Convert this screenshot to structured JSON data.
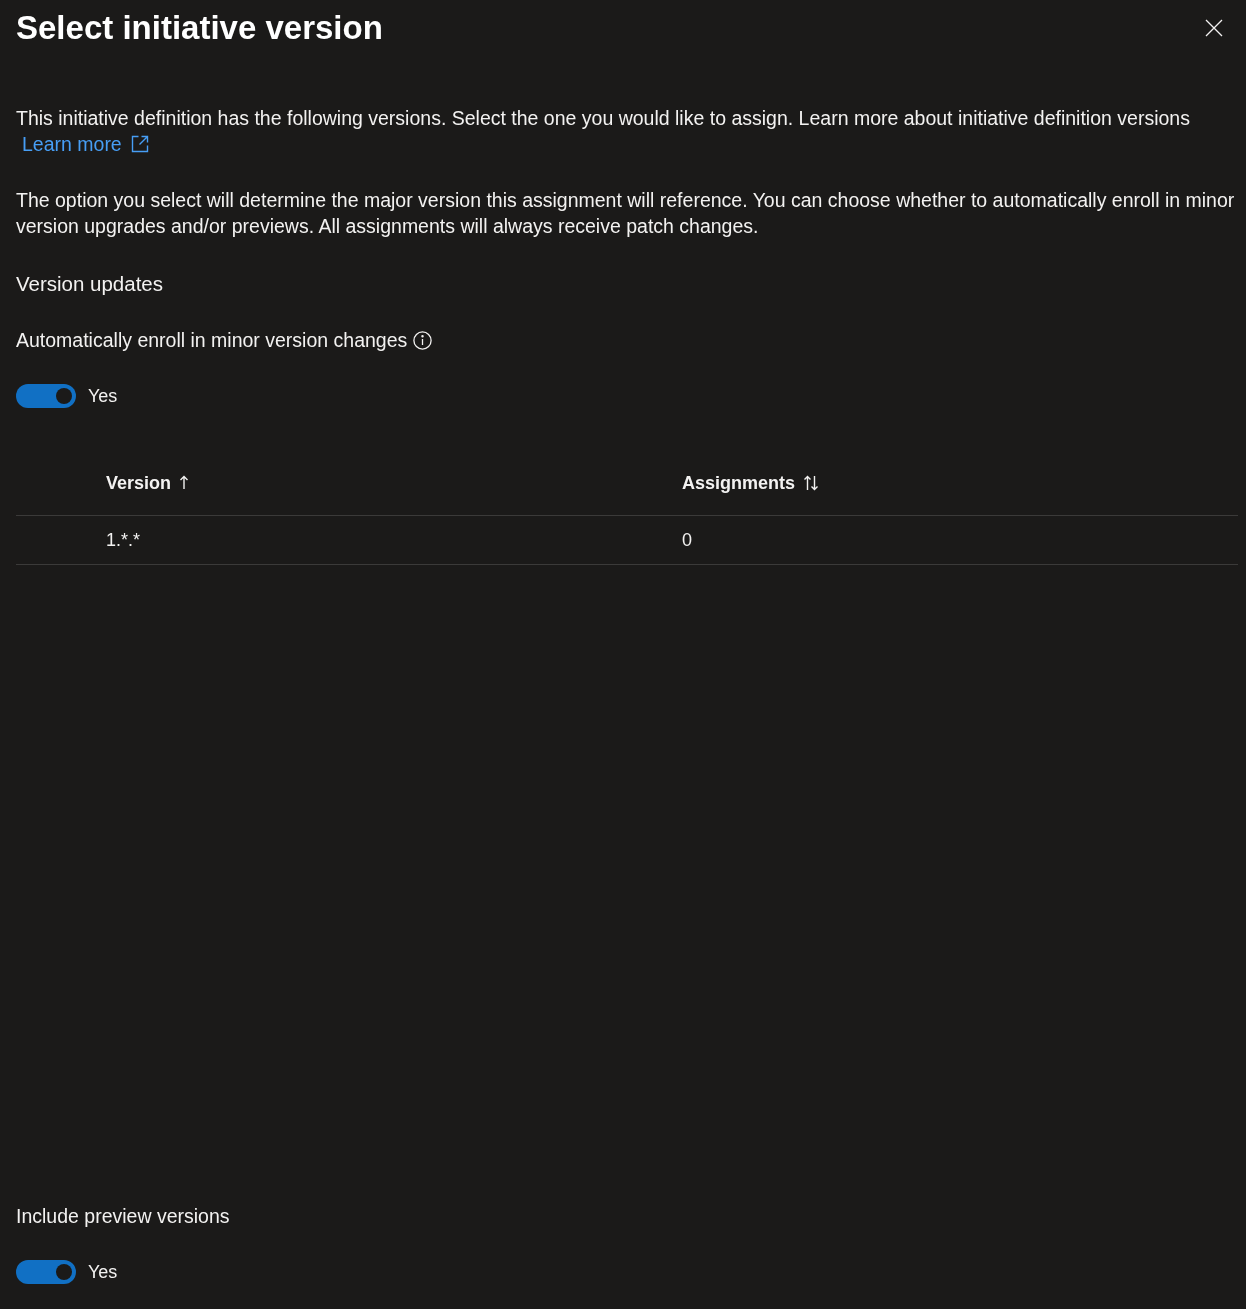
{
  "panel": {
    "title": "Select initiative version"
  },
  "intro": {
    "text": "This initiative definition has the following versions. Select the one you would like to assign. Learn more about initiative definition versions",
    "link": "Learn more"
  },
  "description": "The option you select will determine the major version this assignment will reference. You can choose whether to automatically enroll in minor version upgrades and/or previews. All assignments will always receive patch changes.",
  "section_title": "Version updates",
  "minor_updates": {
    "label": "Automatically enroll in minor version changes",
    "toggle": {
      "on": true,
      "text": "Yes"
    }
  },
  "table": {
    "columns": [
      {
        "label": "Version",
        "sorted": true
      },
      {
        "label": "Assignments",
        "sorted": false
      }
    ],
    "rows": [
      {
        "cells": [
          "1.*.*",
          "0"
        ]
      }
    ]
  },
  "preview": {
    "label": "Include preview versions",
    "toggle": {
      "on": true,
      "text": "Yes"
    }
  }
}
